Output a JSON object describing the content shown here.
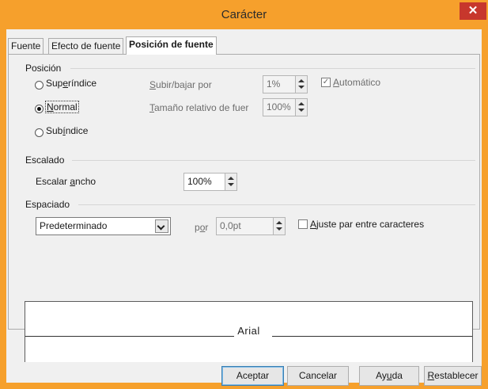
{
  "window": {
    "title": "Carácter",
    "close_glyph": "✕"
  },
  "tabs": [
    "Fuente",
    "Efecto de fuente",
    "Posición de fuente"
  ],
  "position": {
    "heading": "Posición",
    "superscript": {
      "pre": "Sup",
      "mn": "e",
      "post": "ríndice"
    },
    "normal": {
      "pre": "",
      "mn": "N",
      "post": "ormal"
    },
    "subscript": {
      "pre": "Sub",
      "mn": "í",
      "post": "ndice"
    },
    "raise_lower": {
      "mn": "S",
      "post": "ubir/bajar por",
      "value": "1%"
    },
    "relative_size": {
      "mn": "T",
      "post": "amaño relativo de fuer",
      "value": "100%"
    },
    "auto": {
      "pre": "",
      "mn": "A",
      "post": "utomático",
      "checkmark": "✓"
    }
  },
  "scaling": {
    "heading": "Escalado",
    "width_label": {
      "pre": "Escalar ",
      "mn": "a",
      "post": "ncho"
    },
    "width_value": "100%"
  },
  "spacing": {
    "heading": "Espaciado",
    "mode": "Predeterminado",
    "by": {
      "pre": "p",
      "mn": "o",
      "post": "r"
    },
    "by_value": "0,0pt",
    "kerning": {
      "pre": "",
      "mn": "A",
      "post": "juste par entre caracteres"
    }
  },
  "preview": {
    "text": "Arial"
  },
  "buttons": {
    "ok": "Aceptar",
    "cancel": "Cancelar",
    "help": {
      "pre": "Ay",
      "mn": "u",
      "post": "da"
    },
    "reset": {
      "pre": "",
      "mn": "R",
      "post": "establecer"
    }
  },
  "colors": {
    "window_frame": "#f6a02c",
    "close_button": "#c7372c"
  }
}
